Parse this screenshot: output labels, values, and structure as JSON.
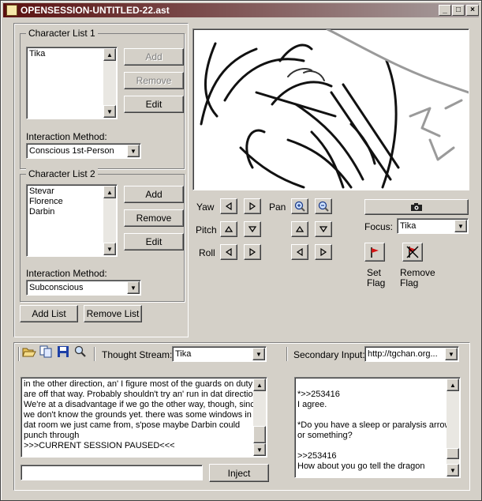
{
  "window": {
    "title": "OPENSESSION-UNTITLED-22.ast"
  },
  "colors": {
    "titlebar_start": "#5a1010",
    "titlebar_end": "#a8a0a0",
    "face": "#d4d0c8"
  },
  "character_list_1": {
    "legend": "Character List 1",
    "items": [
      "Tika"
    ],
    "add_label": "Add",
    "remove_label": "Remove",
    "edit_label": "Edit",
    "interaction_label": "Interaction Method:",
    "interaction_value": "Conscious 1st-Person"
  },
  "character_list_2": {
    "legend": "Character List 2",
    "items": [
      "Stevar",
      "Florence",
      "Darbin"
    ],
    "add_label": "Add",
    "remove_label": "Remove",
    "edit_label": "Edit",
    "interaction_label": "Interaction Method:",
    "interaction_value": "Subconscious"
  },
  "list_actions": {
    "add_list_label": "Add List",
    "remove_list_label": "Remove List"
  },
  "view_controls": {
    "yaw_label": "Yaw",
    "pitch_label": "Pitch",
    "roll_label": "Roll",
    "pan_label": "Pan",
    "focus_label": "Focus:",
    "focus_value": "Tika",
    "set_flag_label": "Set\nFlag",
    "remove_flag_label": "Remove\nFlag",
    "camera_icon": "camera-icon"
  },
  "toolbar": {
    "thought_stream_label": "Thought Stream:",
    "thought_stream_value": "Tika",
    "secondary_input_label": "Secondary Input:",
    "secondary_input_value": "http://tgchan.org..."
  },
  "thought_log": {
    "lines": [
      "in the other direction, an' I figure most of the guards on duty",
      "are off that way.  Probably shouldn't try an' run in dat direction.",
      " We're at a disadvantage if we go the other way, though, since",
      "we don't know the grounds yet.  there was some windows in",
      "dat room we just came from, s'pose maybe Darbin could",
      "punch through",
      ">>>CURRENT SESSION PAUSED<<<"
    ]
  },
  "secondary_log": {
    "lines": [
      "",
      "*>>253416",
      "I agree.",
      "",
      "*Do you have a sleep or paralysis arrow",
      "or something?",
      "",
      ">>253416",
      "How about you go tell the dragon"
    ]
  },
  "inject": {
    "input_value": "",
    "button_label": "Inject"
  }
}
